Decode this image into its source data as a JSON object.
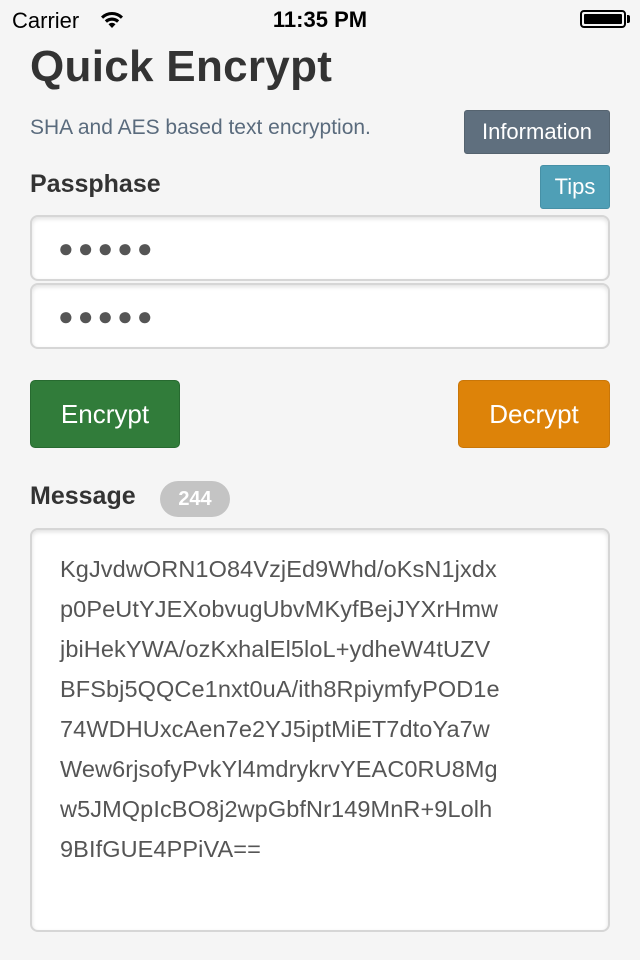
{
  "status_bar": {
    "carrier": "Carrier",
    "time": "11:35 PM",
    "wifi_icon": "wifi-icon",
    "battery_icon": "battery-icon",
    "battery_level": 1.0
  },
  "header": {
    "title": "Quick Encrypt",
    "subtitle": "SHA and AES based text encryption.",
    "info_button": "Information"
  },
  "passphrase": {
    "label": "Passphase",
    "tips_button": "Tips",
    "field1_value": "●●●●●",
    "field2_value": "●●●●●"
  },
  "actions": {
    "encrypt_label": "Encrypt",
    "decrypt_label": "Decrypt"
  },
  "message": {
    "label": "Message",
    "count_badge": "244",
    "lines": [
      "KgJvdwORN1O84VzjEd9Whd/oKsN1jxdx",
      "p0PeUtYJEXobvugUbvMKyfBejJYXrHmw",
      "jbiHekYWA/ozKxhalEl5loL+ydheW4tUZV",
      "BFSbj5QQCe1nxt0uA/ith8RpiymfyPOD1e",
      "74WDHUxcAen7e2YJ5iptMiET7dtoYa7w",
      "Wew6rjsofyPvkYl4mdrykrvYEAC0RU8Mg",
      "w5JMQpIcBO8j2wpGbfNr149MnR+9Lolh",
      "9BIfGUE4PPiVA=="
    ]
  },
  "colors": {
    "info_button": "#5f6f7e",
    "tips_button": "#4f9fb6",
    "encrypt_button": "#317c3a",
    "decrypt_button": "#dd8309",
    "badge": "#c4c4c4",
    "background": "#f5f5f5"
  }
}
